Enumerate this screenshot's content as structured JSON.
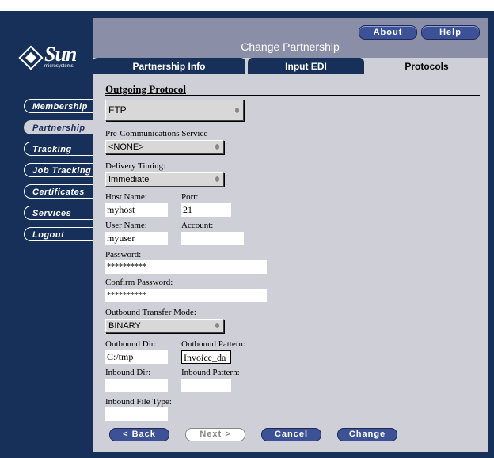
{
  "brand": {
    "name": "Sun",
    "tagline": "microsystems"
  },
  "sidebar": {
    "items": [
      {
        "label": "Membership"
      },
      {
        "label": "Partnership"
      },
      {
        "label": "Tracking"
      },
      {
        "label": "Job Tracking"
      },
      {
        "label": "Certificates"
      },
      {
        "label": "Services"
      },
      {
        "label": "Logout"
      }
    ],
    "active": "Partnership"
  },
  "header": {
    "title": "Change Partnership",
    "about_label": "About",
    "help_label": "Help"
  },
  "tabs": [
    {
      "label": "Partnership Info"
    },
    {
      "label": "Input EDI"
    },
    {
      "label": "Protocols"
    }
  ],
  "active_tab": "Protocols",
  "form": {
    "section_title": "Outgoing Protocol",
    "protocol": "FTP",
    "pre_comm_label": "Pre-Communications Service",
    "pre_comm_value": "<NONE>",
    "delivery_label": "Delivery Timing:",
    "delivery_value": "Immediate",
    "host_label": "Host Name:",
    "host_value": "myhost",
    "port_label": "Port:",
    "port_value": "21",
    "user_label": "User Name:",
    "user_value": "myuser",
    "account_label": "Account:",
    "account_value": "",
    "password_label": "Password:",
    "password_value": "**********",
    "confirm_label": "Confirm Password:",
    "confirm_value": "**********",
    "transfer_label": "Outbound Transfer Mode:",
    "transfer_value": "BINARY",
    "out_dir_label": "Outbound Dir:",
    "out_dir_value": "C:/tmp",
    "out_pattern_label": "Outbound Pattern:",
    "out_pattern_value": "Invoice_da",
    "in_dir_label": "Inbound Dir:",
    "in_dir_value": "",
    "in_pattern_label": "Inbound Pattern:",
    "in_pattern_value": "",
    "in_type_label": "Inbound File Type:",
    "in_type_value": ""
  },
  "buttons": {
    "back": "< Back",
    "next": "Next >",
    "cancel": "Cancel",
    "change": "Change"
  }
}
